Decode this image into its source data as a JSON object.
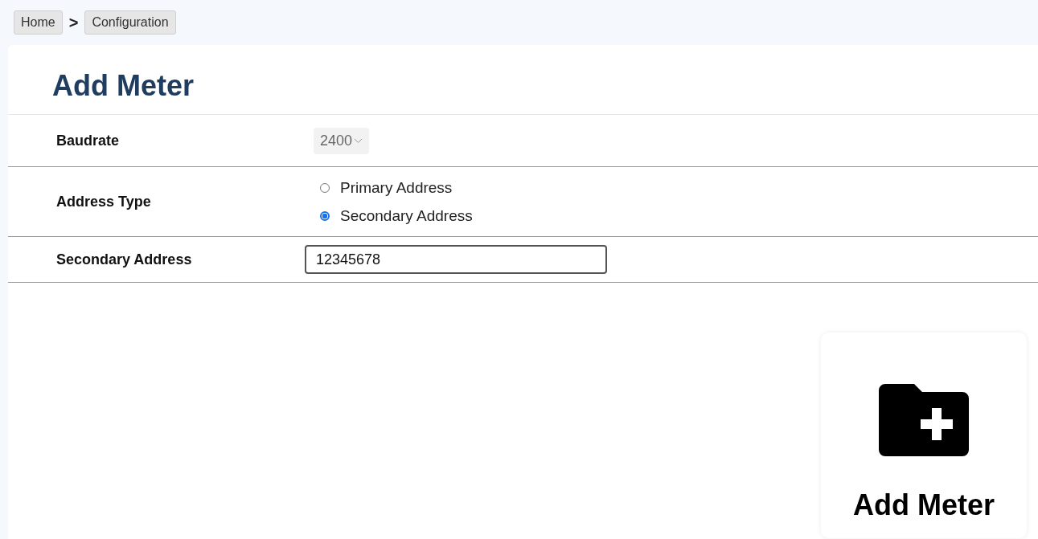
{
  "breadcrumb": {
    "items": [
      "Home",
      "Configuration"
    ],
    "separator": ">"
  },
  "title": "Add Meter",
  "form": [
    {
      "kind": "select",
      "label": "Baudrate",
      "value": "2400"
    },
    {
      "kind": "radio",
      "label": "Address Type",
      "options": [
        {
          "label": "Primary Address",
          "selected": false
        },
        {
          "label": "Secondary Address",
          "selected": true
        }
      ]
    },
    {
      "kind": "text",
      "label": "Secondary Address",
      "value": "12345678"
    }
  ],
  "action": {
    "label": "Add Meter"
  }
}
